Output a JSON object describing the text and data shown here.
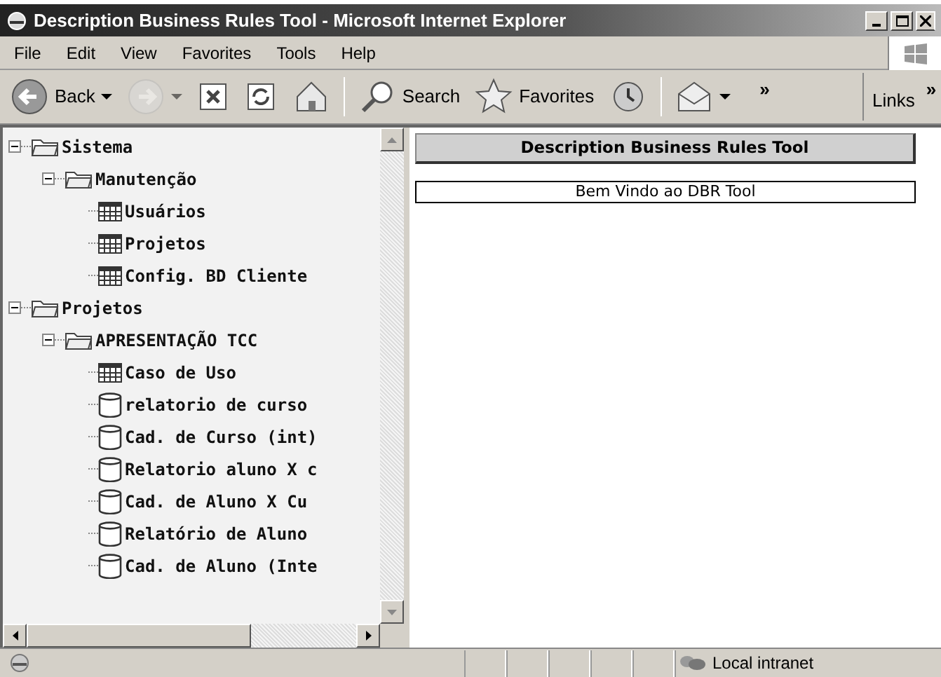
{
  "window": {
    "title": "Description Business Rules Tool - Microsoft Internet Explorer"
  },
  "menu": [
    {
      "label": "File"
    },
    {
      "label": "Edit"
    },
    {
      "label": "View"
    },
    {
      "label": "Favorites"
    },
    {
      "label": "Tools"
    },
    {
      "label": "Help"
    }
  ],
  "toolbar": [
    {
      "kind": "back",
      "label": "Back",
      "disabled": false
    },
    {
      "kind": "forward",
      "disabled": true
    },
    {
      "kind": "stop",
      "disabled": false
    },
    {
      "kind": "refresh",
      "disabled": false
    },
    {
      "kind": "home",
      "disabled": false
    },
    {
      "kind": "search",
      "label": "Search",
      "disabled": false
    },
    {
      "kind": "favorites",
      "label": "Favorites",
      "disabled": false
    },
    {
      "kind": "history",
      "disabled": false
    },
    {
      "kind": "mail",
      "disabled": false
    }
  ],
  "toolbar_more": "»",
  "links": {
    "label": "Links",
    "more": "»"
  },
  "tree": [
    {
      "kind": "folder",
      "label": "Sistema",
      "expanded": true,
      "children": [
        {
          "kind": "folder",
          "label": "Manutenção",
          "expanded": true,
          "children": [
            {
              "kind": "table",
              "label": "Usuários"
            },
            {
              "kind": "table",
              "label": "Projetos"
            },
            {
              "kind": "table",
              "label": "Config. BD Cliente"
            }
          ]
        }
      ]
    },
    {
      "kind": "folder",
      "label": "Projetos",
      "expanded": true,
      "children": [
        {
          "kind": "folder",
          "label": "APRESENTAÇÃO TCC",
          "expanded": true,
          "children": [
            {
              "kind": "table",
              "label": "Caso de Uso"
            },
            {
              "kind": "database",
              "label": "relatorio de curso"
            },
            {
              "kind": "database",
              "label": "Cad. de Curso (int)"
            },
            {
              "kind": "database",
              "label": "Relatorio aluno X c"
            },
            {
              "kind": "database",
              "label": "Cad. de Aluno X Cu"
            },
            {
              "kind": "database",
              "label": "Relatório de Aluno"
            },
            {
              "kind": "database",
              "label": "Cad. de Aluno (Inte"
            }
          ]
        }
      ]
    }
  ],
  "content": {
    "heading": "Description Business Rules Tool",
    "welcome": "Bem Vindo ao DBR Tool"
  },
  "status_bar": {
    "zone": "Local intranet"
  }
}
